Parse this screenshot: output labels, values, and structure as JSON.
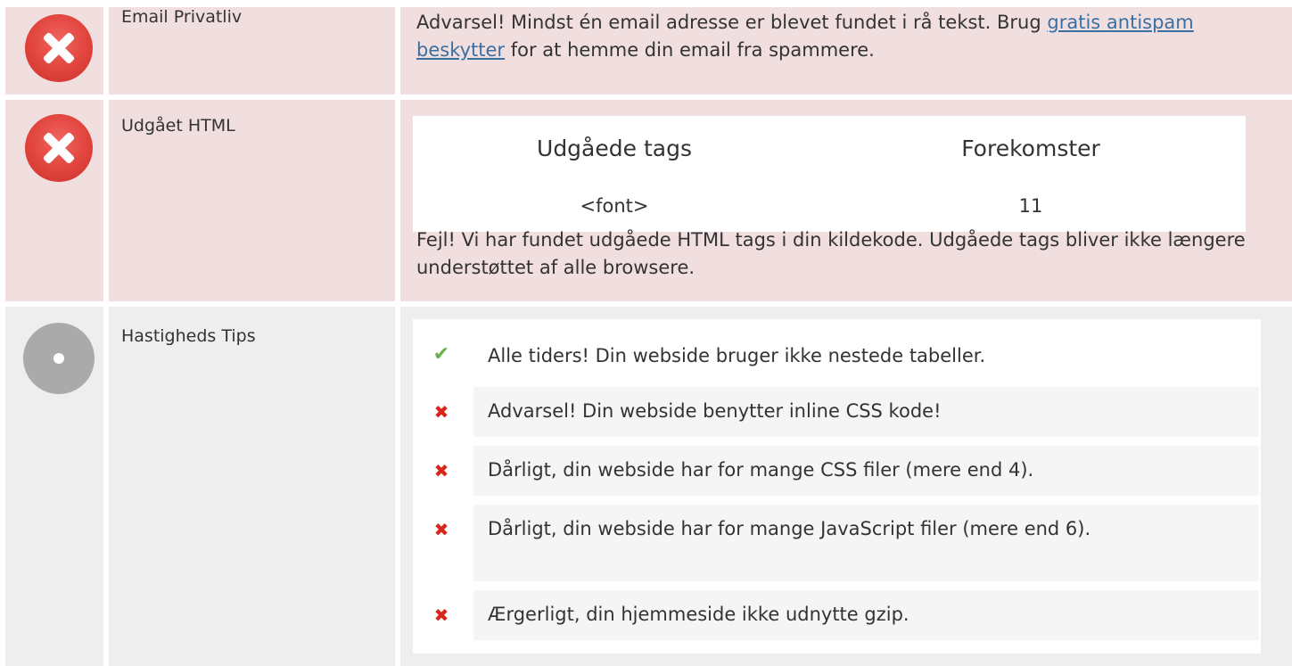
{
  "rows": [
    {
      "status": "error",
      "label": "Email Privatliv",
      "text_before": "Advarsel! Mindst én email adresse er blevet fundet i rå tekst. Brug ",
      "link_text": "gratis antispam beskytter",
      "text_after": " for at hemme din email fra spammere."
    },
    {
      "status": "error",
      "label": "Udgået HTML",
      "table": {
        "headers": [
          "Udgåede tags",
          "Forekomster"
        ],
        "rows": [
          [
            "<font>",
            "11"
          ]
        ]
      },
      "message": "Fejl! Vi har fundet udgåede HTML tags i din kildekode. Udgåede tags bliver ikke længere understøttet af alle browsere."
    },
    {
      "status": "neutral",
      "label": "Hastigheds Tips",
      "tips": [
        {
          "status": "ok",
          "icon": "check-icon",
          "text": "Alle tiders! Din webside bruger ikke nestede tabeller."
        },
        {
          "status": "bad",
          "icon": "cross-icon",
          "text": "Advarsel! Din webside benytter inline CSS kode!"
        },
        {
          "status": "bad",
          "icon": "cross-icon",
          "text": "Dårligt, din webside har for mange CSS filer (mere end 4)."
        },
        {
          "status": "bad",
          "icon": "cross-icon",
          "text": "Dårligt, din webside har for mange JavaScript filer (mere end 6)."
        },
        {
          "status": "bad",
          "icon": "cross-icon",
          "text": "Ærgerligt, din hjemmeside ikke udnytte gzip."
        }
      ]
    }
  ],
  "colors": {
    "error_row_bg": "#f1dfe0",
    "neutral_row_bg": "#eeeeee",
    "error_icon": "#e0443d",
    "neutral_icon": "#aaaaaa",
    "ok_check": "#6ab04c",
    "bad_cross": "#d9261c",
    "link": "#3a6fa3"
  }
}
